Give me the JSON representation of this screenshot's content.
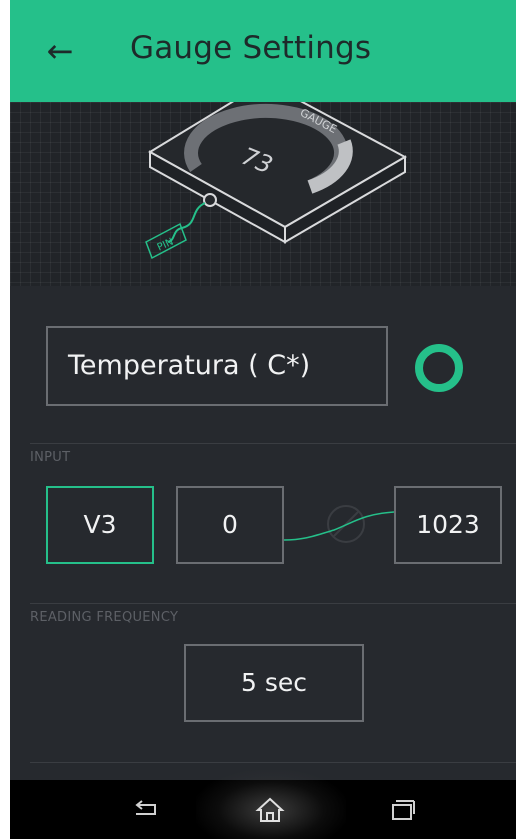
{
  "header": {
    "back_icon": "arrow-left-icon",
    "title": "Gauge Settings",
    "accent_color": "#25c08a"
  },
  "illustration": {
    "gauge_value": "73",
    "gauge_label": "GAUGE",
    "pin_label": "PIN"
  },
  "widget": {
    "name_value": "Temperatura ( C*)",
    "color": "#25c08a"
  },
  "input": {
    "section_label": "INPUT",
    "pin": "V3",
    "min": "0",
    "max": "1023"
  },
  "reading_frequency": {
    "section_label": "READING FREQUENCY",
    "value": "5 sec"
  },
  "navbar": {
    "back_icon": "nav-back-icon",
    "home_icon": "home-icon",
    "recents_icon": "recents-icon"
  }
}
